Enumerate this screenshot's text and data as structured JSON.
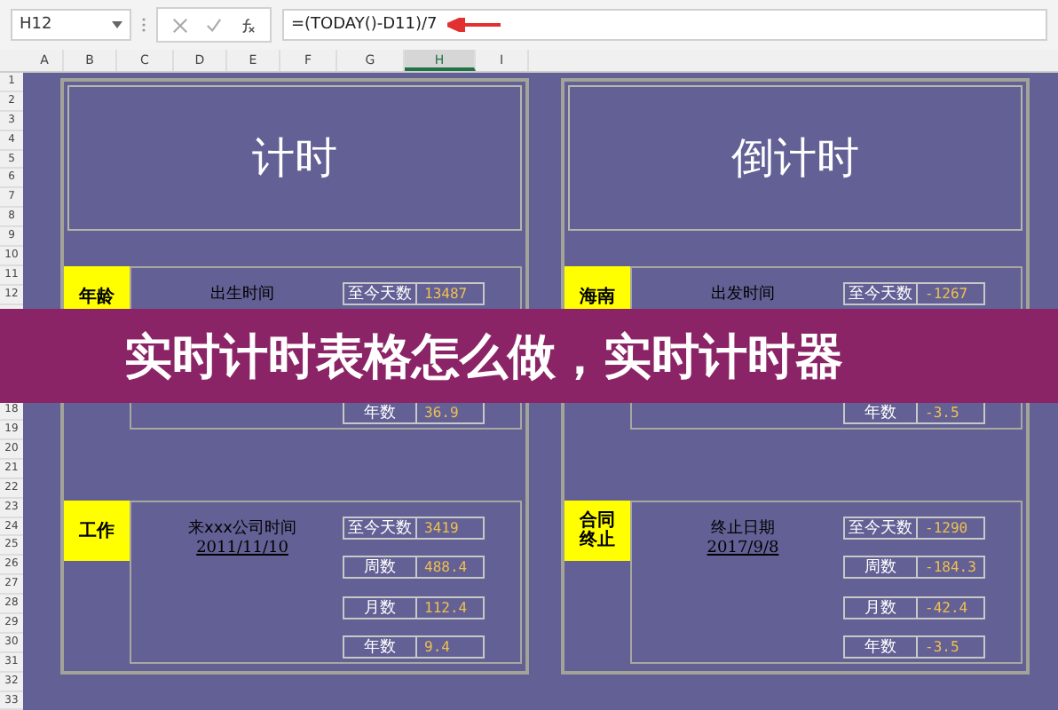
{
  "formula_bar": {
    "name_box": "H12",
    "formula": "=(TODAY()-D11)/7"
  },
  "columns": [
    {
      "label": "A",
      "selected": false
    },
    {
      "label": "B",
      "selected": false
    },
    {
      "label": "C",
      "selected": false
    },
    {
      "label": "D",
      "selected": false
    },
    {
      "label": "E",
      "selected": false
    },
    {
      "label": "F",
      "selected": false
    },
    {
      "label": "G",
      "selected": false
    },
    {
      "label": "H",
      "selected": true
    },
    {
      "label": "I",
      "selected": false
    }
  ],
  "rows_above": [
    "1",
    "2",
    "3",
    "4",
    "5",
    "6",
    "7",
    "8",
    "9",
    "10",
    "11",
    "12"
  ],
  "rows_below": [
    "18",
    "19",
    "20",
    "21",
    "22",
    "23",
    "24",
    "25",
    "26",
    "27",
    "28",
    "29",
    "30",
    "31",
    "32",
    "33"
  ],
  "panels": [
    {
      "title": "计时",
      "sections": [
        {
          "tag": "年龄",
          "label": "出生时间",
          "stats": [
            {
              "label": "至今天数",
              "value": "13487"
            },
            {
              "label": "年数",
              "value": "36.9"
            }
          ]
        },
        {
          "tag": "工作",
          "label": "来xxx公司时间",
          "date": "2011/11/10",
          "stats": [
            {
              "label": "至今天数",
              "value": "3419"
            },
            {
              "label": "周数",
              "value": "488.4"
            },
            {
              "label": "月数",
              "value": "112.4"
            },
            {
              "label": "年数",
              "value": "9.4"
            }
          ]
        }
      ]
    },
    {
      "title": "倒计时",
      "sections": [
        {
          "tag": "海南",
          "label": "出发时间",
          "stats": [
            {
              "label": "至今天数",
              "value": "-1267"
            },
            {
              "label": "年数",
              "value": "-3.5"
            }
          ]
        },
        {
          "tag": "合同终止",
          "label": "终止日期",
          "date": "2017/9/8",
          "stats": [
            {
              "label": "至今天数",
              "value": "-1290"
            },
            {
              "label": "周数",
              "value": "-184.3"
            },
            {
              "label": "月数",
              "value": "-42.4"
            },
            {
              "label": "年数",
              "value": "-3.5"
            }
          ]
        }
      ]
    }
  ],
  "banner": {
    "text": "实时计时表格怎么做，实时计时器"
  }
}
